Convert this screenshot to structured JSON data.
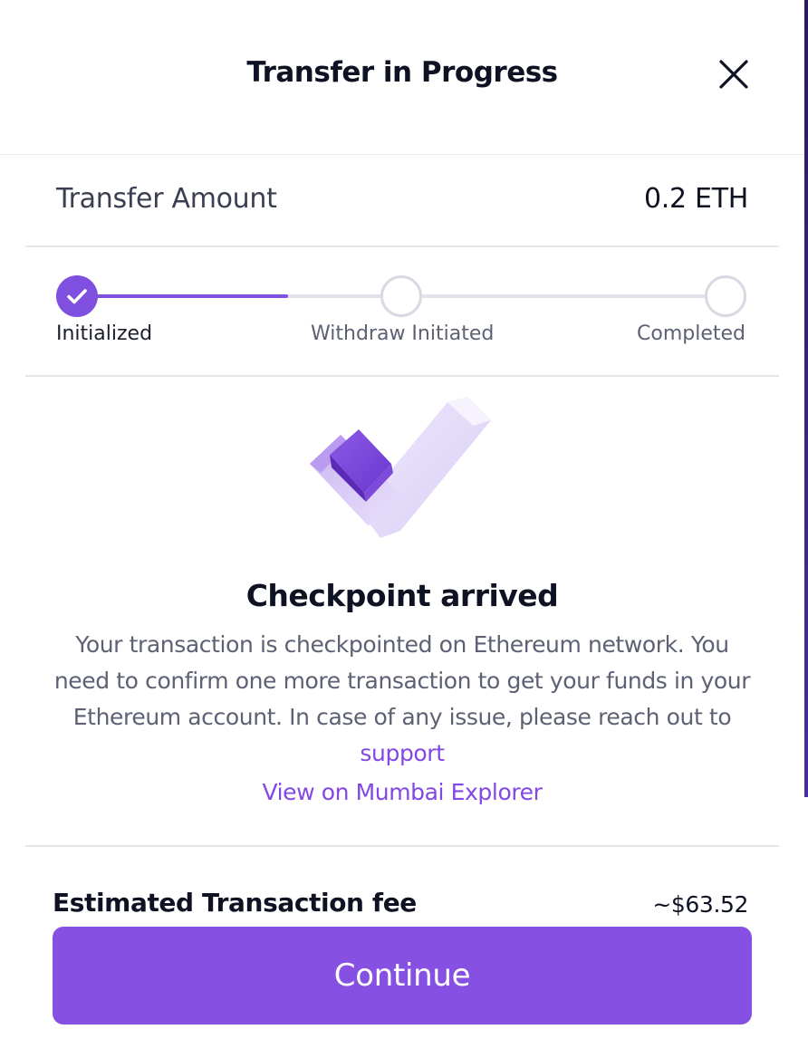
{
  "modal": {
    "title": "Transfer in Progress",
    "close_icon": "close-icon"
  },
  "transfer": {
    "amount_label": "Transfer Amount",
    "amount_value": "0.2 ETH"
  },
  "stepper": {
    "current_step": 1,
    "progress_fraction": 0.33,
    "steps": [
      {
        "label": "Initialized",
        "state": "done",
        "icon": "check-icon"
      },
      {
        "label": "Withdraw Initiated",
        "state": "pending"
      },
      {
        "label": "Completed",
        "state": "pending"
      }
    ]
  },
  "status": {
    "illustration_icon": "checkmark-3d-icon",
    "title": "Checkpoint arrived",
    "description": "Your transaction is checkpointed on Ethereum network. You need to confirm one more transaction to get your funds in your Ethereum account. In case of any issue, please reach out to",
    "support_link": "support",
    "explorer_link": "View on Mumbai Explorer"
  },
  "fee": {
    "label": "Estimated Transaction fee",
    "value": "~$63.52"
  },
  "actions": {
    "continue_label": "Continue"
  },
  "colors": {
    "accent": "#8247e5",
    "button": "#8650e3",
    "text_primary": "#0f1222",
    "text_secondary": "#5d6173",
    "divider": "#e4e4ea"
  }
}
